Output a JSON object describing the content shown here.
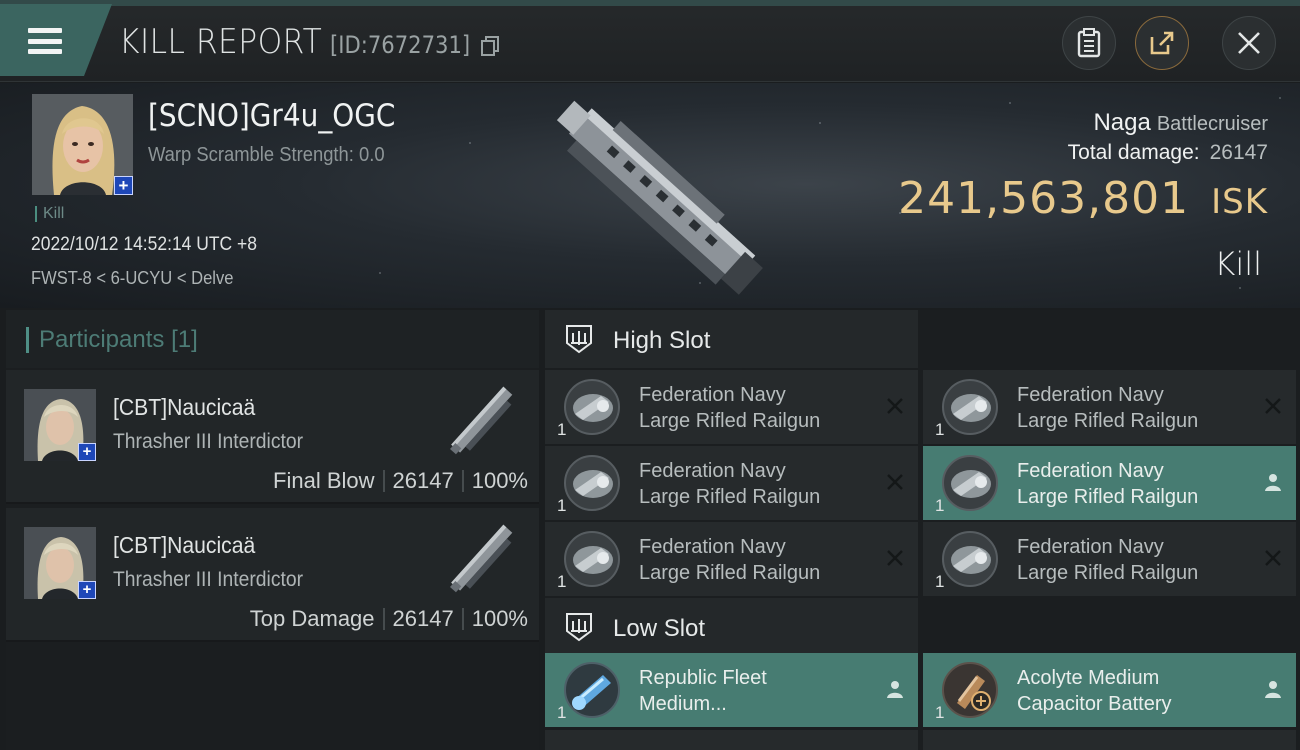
{
  "topbar": {
    "title": "KILL REPORT",
    "report_id": "[ID:7672731]",
    "icons": [
      "menu-icon",
      "copy-icon",
      "clipboard-icon",
      "share-icon",
      "close-icon"
    ]
  },
  "victim": {
    "name": "[SCNO]Gr4u_OGC",
    "warp_scramble": "Warp Scramble Strength: 0.0",
    "tag": "Kill",
    "datetime": "2022/10/12 14:52:14 UTC +8",
    "location": "FWST-8 < 6-UCYU < Delve",
    "ship_name": "Naga",
    "ship_class": "Battlecruiser",
    "total_damage_label": "Total damage:",
    "total_damage": "26147",
    "isk_value": "241,563,801",
    "isk_unit": "ISK",
    "report_type": "Kill"
  },
  "participants": {
    "title": "Participants",
    "count": "[1]",
    "rows": [
      {
        "name": "[CBT]Naucicaä",
        "ship": "Thrasher III Interdictor",
        "role": "Final Blow",
        "damage": "26147",
        "percent": "100%"
      },
      {
        "name": "[CBT]Naucicaä",
        "ship": "Thrasher III Interdictor",
        "role": "Top Damage",
        "damage": "26147",
        "percent": "100%"
      }
    ]
  },
  "high_slot": {
    "label": "High Slot",
    "items": [
      {
        "line1": "Federation Navy",
        "line2": "Large Rifled Railgun",
        "qty": "1",
        "status": "destroyed"
      },
      {
        "line1": "Federation Navy",
        "line2": "Large Rifled Railgun",
        "qty": "1",
        "status": "destroyed"
      },
      {
        "line1": "Federation Navy",
        "line2": "Large Rifled Railgun",
        "qty": "1",
        "status": "destroyed"
      },
      {
        "line1": "Federation Navy",
        "line2": "Large Rifled Railgun",
        "qty": "1",
        "status": "dropped"
      },
      {
        "line1": "Federation Navy",
        "line2": "Large Rifled Railgun",
        "qty": "1",
        "status": "destroyed"
      },
      {
        "line1": "Federation Navy",
        "line2": "Large Rifled Railgun",
        "qty": "1",
        "status": "destroyed"
      }
    ]
  },
  "low_slot": {
    "label": "Low Slot",
    "items": [
      {
        "line1": "Republic Fleet",
        "line2": "Medium...",
        "qty": "1",
        "status": "dropped"
      },
      {
        "line1": "Acolyte Medium",
        "line2": "Capacitor Battery",
        "qty": "1",
        "status": "dropped"
      }
    ]
  },
  "colors": {
    "accent": "#477c72",
    "isk_gold": "#e8c98c",
    "badge_blue": "#1e47b8"
  }
}
